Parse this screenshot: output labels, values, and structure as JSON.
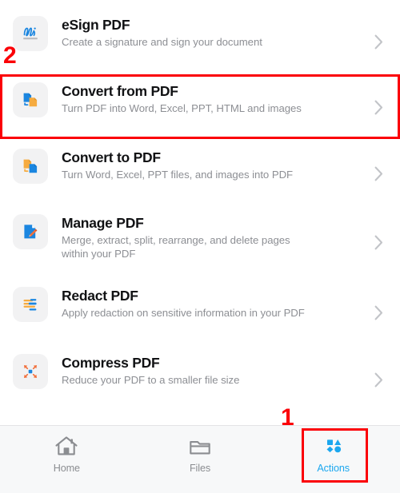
{
  "app": {
    "background": "#ffffff",
    "accent_blue": "#1ba7ef",
    "icon_tile_bg": "#f2f2f3",
    "annotation_red": "#fb0007"
  },
  "actions": {
    "items": [
      {
        "id": "esign-pdf",
        "title": "eSign PDF",
        "subtitle": "Create a signature and sign your document",
        "icon": "signature-icon",
        "chevron": "chevron-right-icon"
      },
      {
        "id": "convert-from-pdf",
        "title": "Convert from PDF",
        "subtitle": "Turn PDF into Word, Excel, PPT, HTML and images",
        "icon": "convert-from-pdf-icon",
        "chevron": "chevron-right-icon"
      },
      {
        "id": "convert-to-pdf",
        "title": "Convert to PDF",
        "subtitle": "Turn Word, Excel, PPT files, and images into PDF",
        "icon": "convert-to-pdf-icon",
        "chevron": "chevron-right-icon"
      },
      {
        "id": "manage-pdf",
        "title": "Manage PDF",
        "subtitle": "Merge, extract, split, rearrange, and delete pages within your PDF",
        "icon": "document-pencil-icon",
        "chevron": "chevron-right-icon"
      },
      {
        "id": "redact-pdf",
        "title": "Redact PDF",
        "subtitle": "Apply redaction on sensitive information in your PDF",
        "icon": "redaction-bars-icon",
        "chevron": "chevron-right-icon"
      },
      {
        "id": "compress-pdf",
        "title": "Compress PDF",
        "subtitle": "Reduce your PDF to a smaller file size",
        "icon": "compress-arrows-icon",
        "chevron": "chevron-right-icon"
      }
    ]
  },
  "tab_bar": {
    "items": [
      {
        "id": "home",
        "label": "Home",
        "icon": "home-icon",
        "active": false
      },
      {
        "id": "files",
        "label": "Files",
        "icon": "folder-icon",
        "active": false
      },
      {
        "id": "actions",
        "label": "Actions",
        "icon": "shapes-icon",
        "active": true
      }
    ]
  },
  "annotations": {
    "step_1": "1",
    "step_2": "2"
  }
}
